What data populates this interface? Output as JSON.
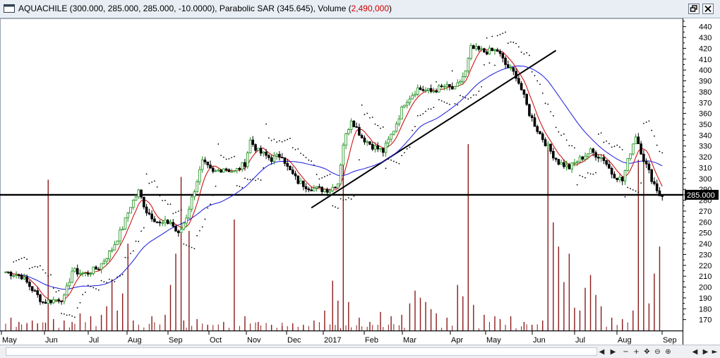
{
  "window": {
    "title": "AQUACHILE (300.000, 285.000, 285.000, -10.0000), Parabolic SAR (345.645), Volume (2,490,000)",
    "title_color": "#000000",
    "volume_label_color": "#cc0000"
  },
  "chart_data": {
    "type": "candlestick",
    "symbol": "AQUACHILE",
    "last_price_label": "285.000",
    "y_axis": {
      "min": 160,
      "max": 445,
      "ticks": [
        "170",
        "180",
        "190",
        "200",
        "210",
        "220",
        "230",
        "240",
        "250",
        "260",
        "270",
        "280",
        "290",
        "300",
        "310",
        "320",
        "330",
        "340",
        "350",
        "360",
        "370",
        "380",
        "390",
        "400",
        "410",
        "420",
        "430",
        "440"
      ]
    },
    "x_axis_labels": [
      "May",
      "Jun",
      "Jul",
      "Aug",
      "Sep",
      "Oct",
      "Nov",
      "Dec",
      "2017",
      "Feb",
      "Mar",
      "Apr",
      "May",
      "Jun",
      "Jul",
      "Aug",
      "Sep"
    ],
    "price_path": [
      [
        0,
        214
      ],
      [
        6,
        210
      ],
      [
        10,
        198
      ],
      [
        14,
        186
      ],
      [
        18,
        188
      ],
      [
        22,
        190
      ],
      [
        25,
        215
      ],
      [
        30,
        212
      ],
      [
        35,
        218
      ],
      [
        40,
        235
      ],
      [
        44,
        255
      ],
      [
        47,
        275
      ],
      [
        50,
        288
      ],
      [
        53,
        270
      ],
      [
        58,
        258
      ],
      [
        62,
        260
      ],
      [
        65,
        248
      ],
      [
        68,
        265
      ],
      [
        71,
        290
      ],
      [
        74,
        315
      ],
      [
        78,
        305
      ],
      [
        82,
        310
      ],
      [
        86,
        306
      ],
      [
        90,
        314
      ],
      [
        92,
        335
      ],
      [
        95,
        325
      ],
      [
        100,
        318
      ],
      [
        104,
        322
      ],
      [
        106,
        310
      ],
      [
        110,
        297
      ],
      [
        114,
        292
      ],
      [
        118,
        290
      ],
      [
        122,
        290
      ],
      [
        125,
        296
      ],
      [
        127,
        332
      ],
      [
        130,
        355
      ],
      [
        134,
        338
      ],
      [
        138,
        330
      ],
      [
        142,
        325
      ],
      [
        146,
        345
      ],
      [
        150,
        370
      ],
      [
        155,
        383
      ],
      [
        160,
        380
      ],
      [
        165,
        385
      ],
      [
        169,
        382
      ],
      [
        173,
        398
      ],
      [
        175,
        420
      ],
      [
        180,
        417
      ],
      [
        185,
        418
      ],
      [
        188,
        405
      ],
      [
        192,
        395
      ],
      [
        194,
        382
      ],
      [
        197,
        360
      ],
      [
        200,
        345
      ],
      [
        205,
        325
      ],
      [
        208,
        315
      ],
      [
        212,
        310
      ],
      [
        216,
        318
      ],
      [
        220,
        325
      ],
      [
        225,
        318
      ],
      [
        228,
        305
      ],
      [
        232,
        298
      ],
      [
        235,
        325
      ],
      [
        237,
        340
      ],
      [
        240,
        318
      ],
      [
        243,
        300
      ],
      [
        246,
        285
      ]
    ],
    "moving_average_fast_color": "#cc0000",
    "moving_average_slow_color": "#1a1adb",
    "parabolic_sar_color": "#000000",
    "bull_candle_color": "#1f8f1f",
    "bear_candle_color": "#000000",
    "volume_color": "#8b1a1a",
    "volume_bars": [
      [
        2,
        18
      ],
      [
        5,
        12
      ],
      [
        8,
        9
      ],
      [
        10,
        14
      ],
      [
        12,
        10
      ],
      [
        15,
        11
      ],
      [
        16,
        212
      ],
      [
        18,
        16
      ],
      [
        22,
        14
      ],
      [
        25,
        12
      ],
      [
        28,
        24
      ],
      [
        32,
        20
      ],
      [
        36,
        22
      ],
      [
        38,
        34
      ],
      [
        40,
        72
      ],
      [
        42,
        28
      ],
      [
        44,
        52
      ],
      [
        46,
        122
      ],
      [
        48,
        14
      ],
      [
        55,
        20
      ],
      [
        60,
        22
      ],
      [
        62,
        64
      ],
      [
        64,
        108
      ],
      [
        66,
        216
      ],
      [
        67,
        14
      ],
      [
        69,
        140
      ],
      [
        72,
        16
      ],
      [
        76,
        8
      ],
      [
        82,
        12
      ],
      [
        86,
        156
      ],
      [
        90,
        20
      ],
      [
        95,
        12
      ],
      [
        100,
        8
      ],
      [
        104,
        6
      ],
      [
        108,
        10
      ],
      [
        112,
        8
      ],
      [
        116,
        14
      ],
      [
        120,
        28
      ],
      [
        123,
        70
      ],
      [
        125,
        42
      ],
      [
        127,
        256
      ],
      [
        129,
        40
      ],
      [
        133,
        18
      ],
      [
        137,
        12
      ],
      [
        141,
        26
      ],
      [
        145,
        20
      ],
      [
        149,
        22
      ],
      [
        152,
        38
      ],
      [
        154,
        56
      ],
      [
        156,
        46
      ],
      [
        158,
        40
      ],
      [
        160,
        30
      ],
      [
        162,
        24
      ],
      [
        166,
        18
      ],
      [
        170,
        64
      ],
      [
        172,
        48
      ],
      [
        174,
        262
      ],
      [
        176,
        36
      ],
      [
        180,
        22
      ],
      [
        184,
        20
      ],
      [
        186,
        16
      ],
      [
        190,
        20
      ],
      [
        195,
        12
      ],
      [
        198,
        8
      ],
      [
        202,
        14
      ],
      [
        204,
        258
      ],
      [
        206,
        152
      ],
      [
        208,
        118
      ],
      [
        210,
        68
      ],
      [
        212,
        108
      ],
      [
        214,
        32
      ],
      [
        216,
        28
      ],
      [
        218,
        60
      ],
      [
        220,
        78
      ],
      [
        222,
        50
      ],
      [
        224,
        34
      ],
      [
        228,
        18
      ],
      [
        232,
        16
      ],
      [
        236,
        28
      ],
      [
        238,
        240
      ],
      [
        240,
        248
      ],
      [
        242,
        38
      ],
      [
        244,
        80
      ],
      [
        246,
        118
      ]
    ],
    "volume_scale_max": 280,
    "support_line": {
      "price": 285
    },
    "trend_lines": [
      {
        "from": [
          115,
          273
        ],
        "to": [
          207,
          418
        ]
      }
    ]
  }
}
